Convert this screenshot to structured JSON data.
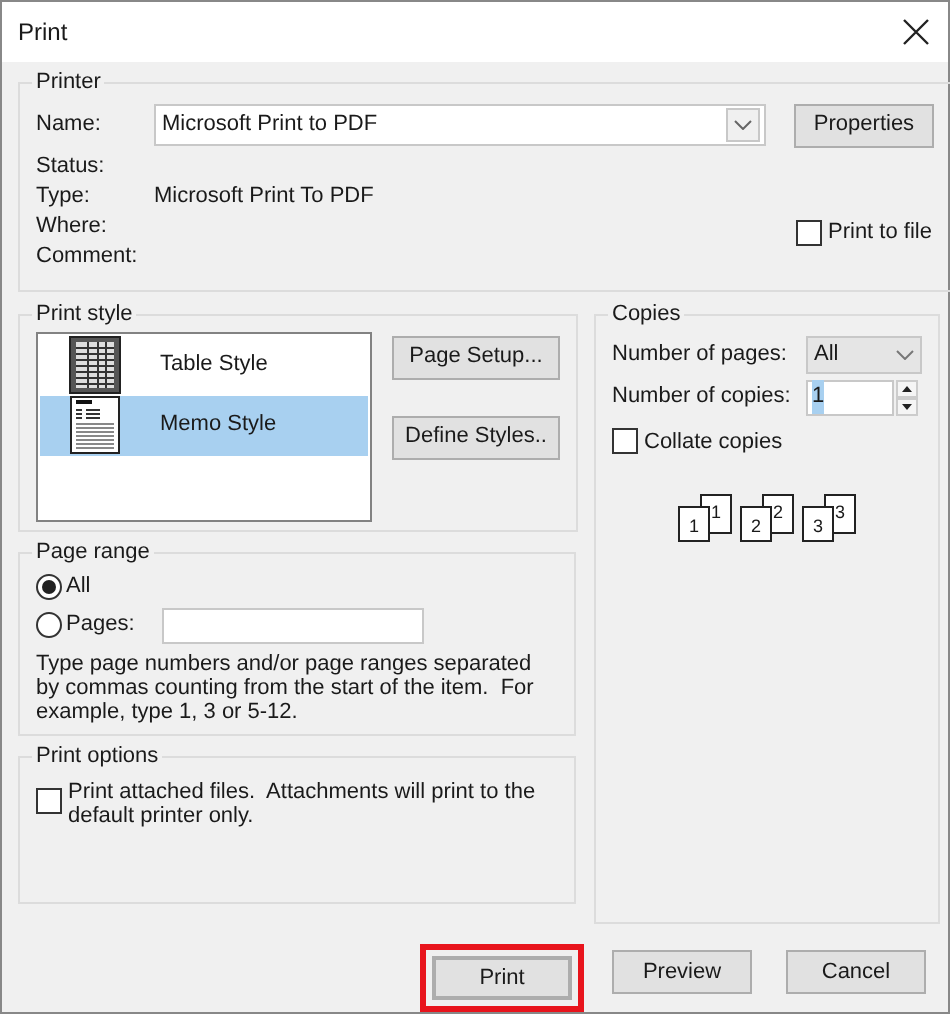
{
  "window": {
    "title": "Print"
  },
  "printer": {
    "group_label": "Printer",
    "name_label": "Name:",
    "name_value": "Microsoft Print to PDF",
    "properties_button": "Properties",
    "info": [
      {
        "label": "Status:"
      },
      {
        "label": "Type:",
        "value": "Microsoft Print To PDF"
      },
      {
        "label": "Where:"
      },
      {
        "label": "Comment:"
      }
    ],
    "print_to_file": {
      "label": "Print to file",
      "checked": false
    }
  },
  "print_style": {
    "group_label": "Print style",
    "styles": [
      {
        "label": "Table Style",
        "kind": "table",
        "selected": false
      },
      {
        "label": "Memo Style",
        "kind": "memo",
        "selected": true
      }
    ],
    "buttons": [
      "Page Setup...",
      "Define Styles.."
    ]
  },
  "copies": {
    "group_label": "Copies",
    "pages_label": "Number of pages:",
    "pages_value": "All",
    "copies_label": "Number of copies:",
    "copies_value": "1",
    "collate": {
      "label": "Collate copies",
      "checked": false
    },
    "sample_sets": [
      {
        "front": "1",
        "back": "1"
      },
      {
        "front": "2",
        "back": "2"
      },
      {
        "front": "3",
        "back": "3"
      }
    ]
  },
  "page_range": {
    "group_label": "Page range",
    "options": [
      {
        "label": "All",
        "selected": true
      },
      {
        "label": "Pages:",
        "selected": false
      }
    ],
    "hint": "Type page numbers and/or page ranges separated by commas counting from the start of the item.  For example, type 1, 3 or 5-12."
  },
  "print_options": {
    "group_label": "Print options",
    "attach": {
      "label": "Print attached files.  Attachments will print to the default printer only.",
      "checked": false
    }
  },
  "buttons": [
    {
      "label": "Print",
      "default": true,
      "highlighted": true
    },
    {
      "label": "Preview",
      "default": false,
      "highlighted": false
    },
    {
      "label": "Cancel",
      "default": false,
      "highlighted": false
    }
  ]
}
